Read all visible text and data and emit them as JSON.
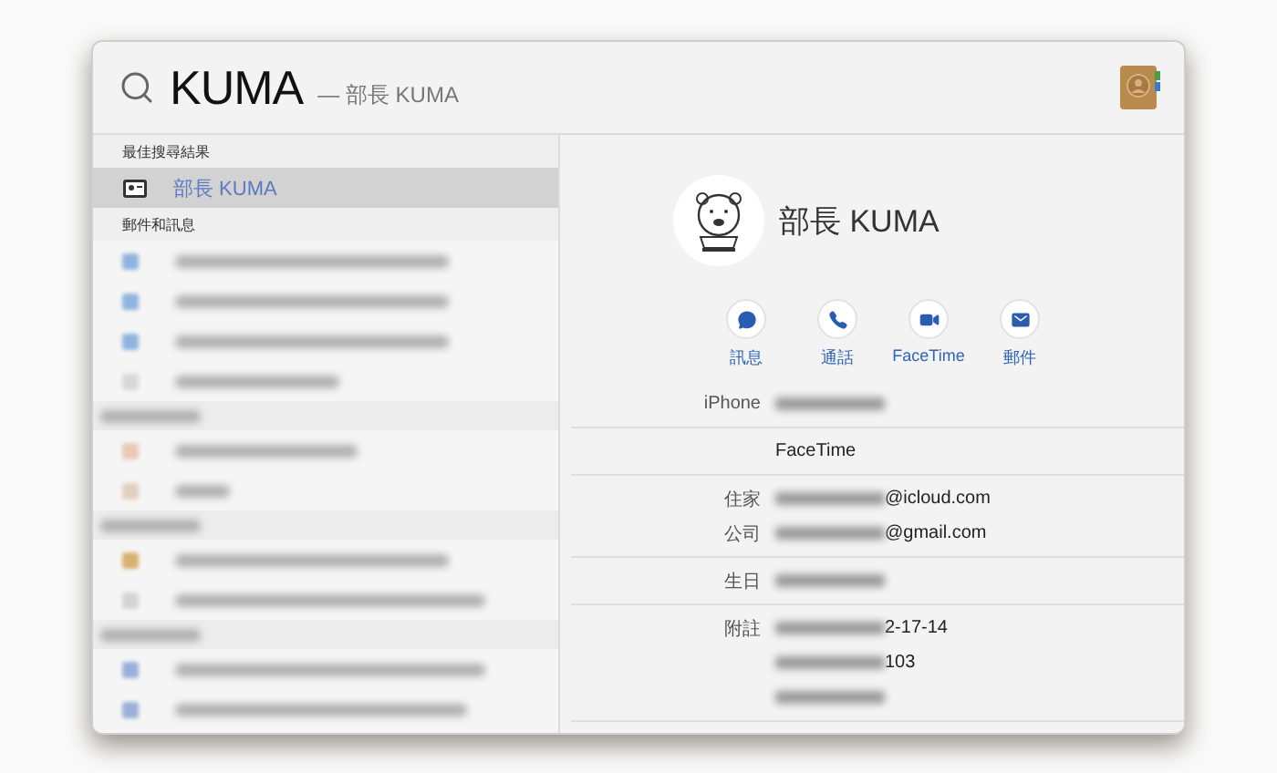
{
  "search": {
    "query": "KUMA",
    "completion": "— 部長 KUMA"
  },
  "results": [
    {
      "kind": "header",
      "label": "最佳搜尋結果"
    },
    {
      "kind": "contact",
      "label": "部長 KUMA",
      "selected": true
    },
    {
      "kind": "header",
      "label": "郵件和訊息"
    },
    {
      "kind": "blurred",
      "color": "#8fb4e0",
      "selected": false
    },
    {
      "kind": "blurred",
      "color": "#8fb4e0",
      "selected": false
    },
    {
      "kind": "blurred",
      "color": "#8fb4e0",
      "selected": false
    },
    {
      "kind": "blurred",
      "color": "#d8d8d8",
      "selected": false
    },
    {
      "kind": "blurred-header"
    },
    {
      "kind": "blurred",
      "color": "#e8c9b8",
      "selected": false
    },
    {
      "kind": "blurred",
      "color": "#e0d0c0",
      "selected": false
    },
    {
      "kind": "blurred-header"
    },
    {
      "kind": "blurred",
      "color": "#d8b070",
      "selected": false
    },
    {
      "kind": "blurred",
      "color": "#d4d4d4",
      "selected": false
    },
    {
      "kind": "blurred-header"
    },
    {
      "kind": "blurred",
      "color": "#9ab0d8",
      "selected": false
    },
    {
      "kind": "blurred",
      "color": "#9ab0d8",
      "selected": false
    }
  ],
  "contact": {
    "name": "部長 KUMA",
    "actions": [
      {
        "kind": "message",
        "label": "訊息"
      },
      {
        "kind": "call",
        "label": "通話"
      },
      {
        "kind": "video",
        "label": "FaceTime"
      },
      {
        "kind": "mail",
        "label": "郵件"
      }
    ],
    "groups": [
      {
        "rows": [
          {
            "label": "iPhone",
            "redacted": true
          }
        ]
      },
      {
        "rows": [
          {
            "value": "FaceTime",
            "redacted": false
          }
        ]
      },
      {
        "rows": [
          {
            "label": "住家",
            "value": "@icloud.com",
            "redacted": true
          },
          {
            "label": "公司",
            "value": "@gmail.com",
            "redacted": true
          }
        ]
      },
      {
        "rows": [
          {
            "label": "生日",
            "redacted": true
          }
        ]
      },
      {
        "rows": [
          {
            "label": "附註",
            "value": "2-17-14",
            "redacted": true
          },
          {
            "value": "103",
            "redacted": true
          },
          {
            "redacted": true
          }
        ]
      }
    ]
  }
}
